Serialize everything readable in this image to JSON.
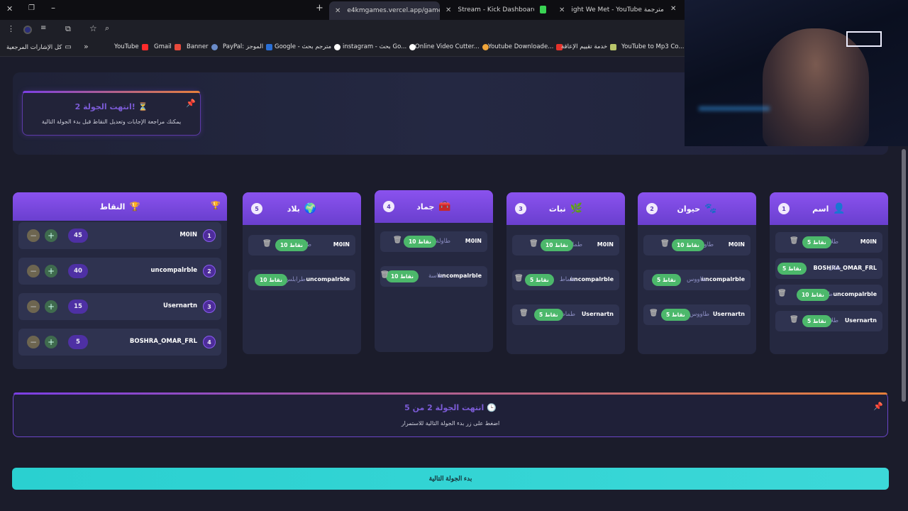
{
  "browser": {
    "tabs": [
      {
        "title": "e4kmgames.vercel.app/games/",
        "active": true
      },
      {
        "title": "Stream - Kick Dashboard",
        "active": false
      },
      {
        "title": "ight We Met - YouTube مترجمة",
        "active": false
      }
    ],
    "new_tab": "+",
    "bookmarks": [
      "كل الإشارات المرجعية",
      "YouTube",
      "Gmail",
      "Banner",
      "PayPal: الموجز",
      "Google - مترجم بحث",
      "instagram - بحث Go...",
      "Online Video Cutter...",
      "Youtube Downloade...",
      "خدمة تقييم الإعاقة",
      "YouTube to Mp3 Co..."
    ],
    "more_bookmarks": "»"
  },
  "round_end_card": {
    "title": "انتهت الجولة 2!",
    "subtitle": "يمكنك مراجعة الإجابات وتعديل النقاط قبل بدء الجولة التالية"
  },
  "columns": [
    {
      "number": "1",
      "title": "اسم",
      "entries": [
        {
          "name": "M0IN",
          "answer": "طلال",
          "points": "5 نقاط"
        },
        {
          "name": "BOSHRA_OMAR_FRL",
          "answer": "طلال",
          "points": "5 نقاط"
        },
        {
          "name": "uncompalrble",
          "answer": "طرزان",
          "points": "10 نقاط"
        },
        {
          "name": "Usernartn",
          "answer": "طلال",
          "points": "5 نقاط"
        }
      ]
    },
    {
      "number": "2",
      "title": "حيوان",
      "entries": [
        {
          "name": "M0IN",
          "answer": "طاووس",
          "points": "10 نقاط"
        },
        {
          "name": "uncompalrble",
          "answer": "طاووس",
          "points": "5 نقاط"
        },
        {
          "name": "Usernartn",
          "answer": "طاووس",
          "points": "5 نقاط"
        }
      ]
    },
    {
      "number": "3",
      "title": "نبات",
      "entries": [
        {
          "name": "M0IN",
          "answer": "طماطم",
          "points": "10 نقاط"
        },
        {
          "name": "uncompalrble",
          "answer": "طماط",
          "points": "5 نقاط"
        },
        {
          "name": "Usernartn",
          "answer": "طماط",
          "points": "5 نقاط"
        }
      ]
    },
    {
      "number": "4",
      "title": "جماد",
      "entries": [
        {
          "name": "M0IN",
          "answer": "طاولة",
          "points": "10 نقاط"
        },
        {
          "name": "uncompalrble",
          "answer": "طاسة",
          "points": "10 نقاط"
        }
      ]
    },
    {
      "number": "5",
      "title": "بلاد",
      "entries": [
        {
          "name": "M0IN",
          "answer": "طوكيو",
          "points": "10 نقاط"
        },
        {
          "name": "uncompalrble",
          "answer": "طرابلس",
          "points": "10 نقاط"
        }
      ]
    }
  ],
  "points_panel": {
    "title": "النقاط",
    "players": [
      {
        "rank": "1",
        "name": "M0IN",
        "score": "45"
      },
      {
        "rank": "2",
        "name": "uncompalrble",
        "score": "40"
      },
      {
        "rank": "3",
        "name": "Usernartn",
        "score": "15"
      },
      {
        "rank": "4",
        "name": "BOSHRA_OMAR_FRL",
        "score": "5"
      }
    ]
  },
  "status_card": {
    "title": "انتهت الجولة 2 من 5",
    "subtitle": "اضغط على زر بدء الجولة التالية للاستمرار"
  },
  "next_button": "بدء الجولة التالية",
  "colors": {
    "accent": "#7b4be0",
    "success": "#4cb86b",
    "cta": "#2ad0d0"
  }
}
